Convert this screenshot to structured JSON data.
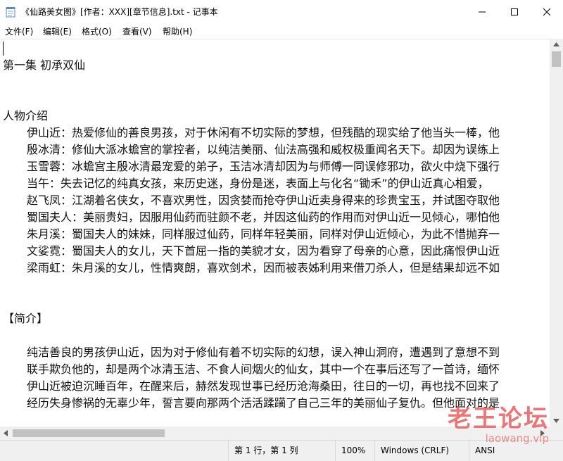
{
  "window": {
    "title": "《仙路美女图》[作者：XXX][章节信息].txt - 记事本",
    "minimize": "─",
    "maximize": "☐",
    "close": "✕"
  },
  "menu": [
    "文件(F)",
    "编辑(E)",
    "格式(O)",
    "查看(V)",
    "帮助(H)"
  ],
  "document": {
    "chapter_title": "第一集 初承双仙",
    "section_characters": "人物介绍",
    "characters": [
      "伊山近：热爱修仙的善良男孩，对于休闲有不切实际的梦想，但残酷的现实给了他当头一棒，他",
      "殷冰清：修仙大派冰蟾宫的掌控者，以纯洁美丽、仙法高强和威权极重闻名天下。却因为误练上",
      "玉雪蓉：冰蟾宫主殷冰清最宠爱的弟子，玉洁冰清却因为与师傅一同误修邪功，欲火中烧下强行",
      "当午：失去记忆的纯真女孩，来历史迷，身份是迷，表面上与化名“锄禾”的伊山近真心相爱，",
      "赵飞凤：江湖着名侠女，不喜欢男性，因贪婪而抢夺伊山近卖身得来的珍贵宝玉，并试图夺取他",
      "蜀国夫人：美丽贵妇，因服用仙药而驻颜不老，并因这仙药的作用而对伊山近一见倾心，哪怕他",
      "朱月溪：蜀国夫人的妹妹，同样服过仙药，同样年轻美丽，同样对伊山近倾心，为此不惜抛弃一",
      "文娑霓：蜀国夫人的女儿，天下首屈一指的美貌才女，因为看穿了母亲的心意，因此痛恨伊山近",
      "梁雨虹：朱月溪的女儿，性情爽朗，喜欢剑术，因而被表姊利用来借刀杀人，但是结果却远不如"
    ],
    "section_intro": "【简介】",
    "intro": [
      "纯洁善良的男孩伊山近，因为对于修仙有着不切实际的幻想，误入神山洞府，遭遇到了意想不到",
      "联手欺负他的，却是两个冰清玉洁、不食人间烟火的仙女，其中一个在事后还写了一首诗，缅怀",
      "伊山近被迫沉睡百年，在醒来后，赫然发现世事已经历沧海桑田，往日的一切，再也找不回来了",
      "经历失身惨祸的无辜少年，誓言要向那两个活活蹂躏了自己三年的美丽仙子复仇。但他面对的是"
    ]
  },
  "status": {
    "position": "第 1 行，第 1 列",
    "zoom": "100%",
    "line_ending": "Windows (CRLF)",
    "encoding": "ANSI"
  },
  "watermark": {
    "name": "老王论坛",
    "url": "laowang.vip"
  }
}
